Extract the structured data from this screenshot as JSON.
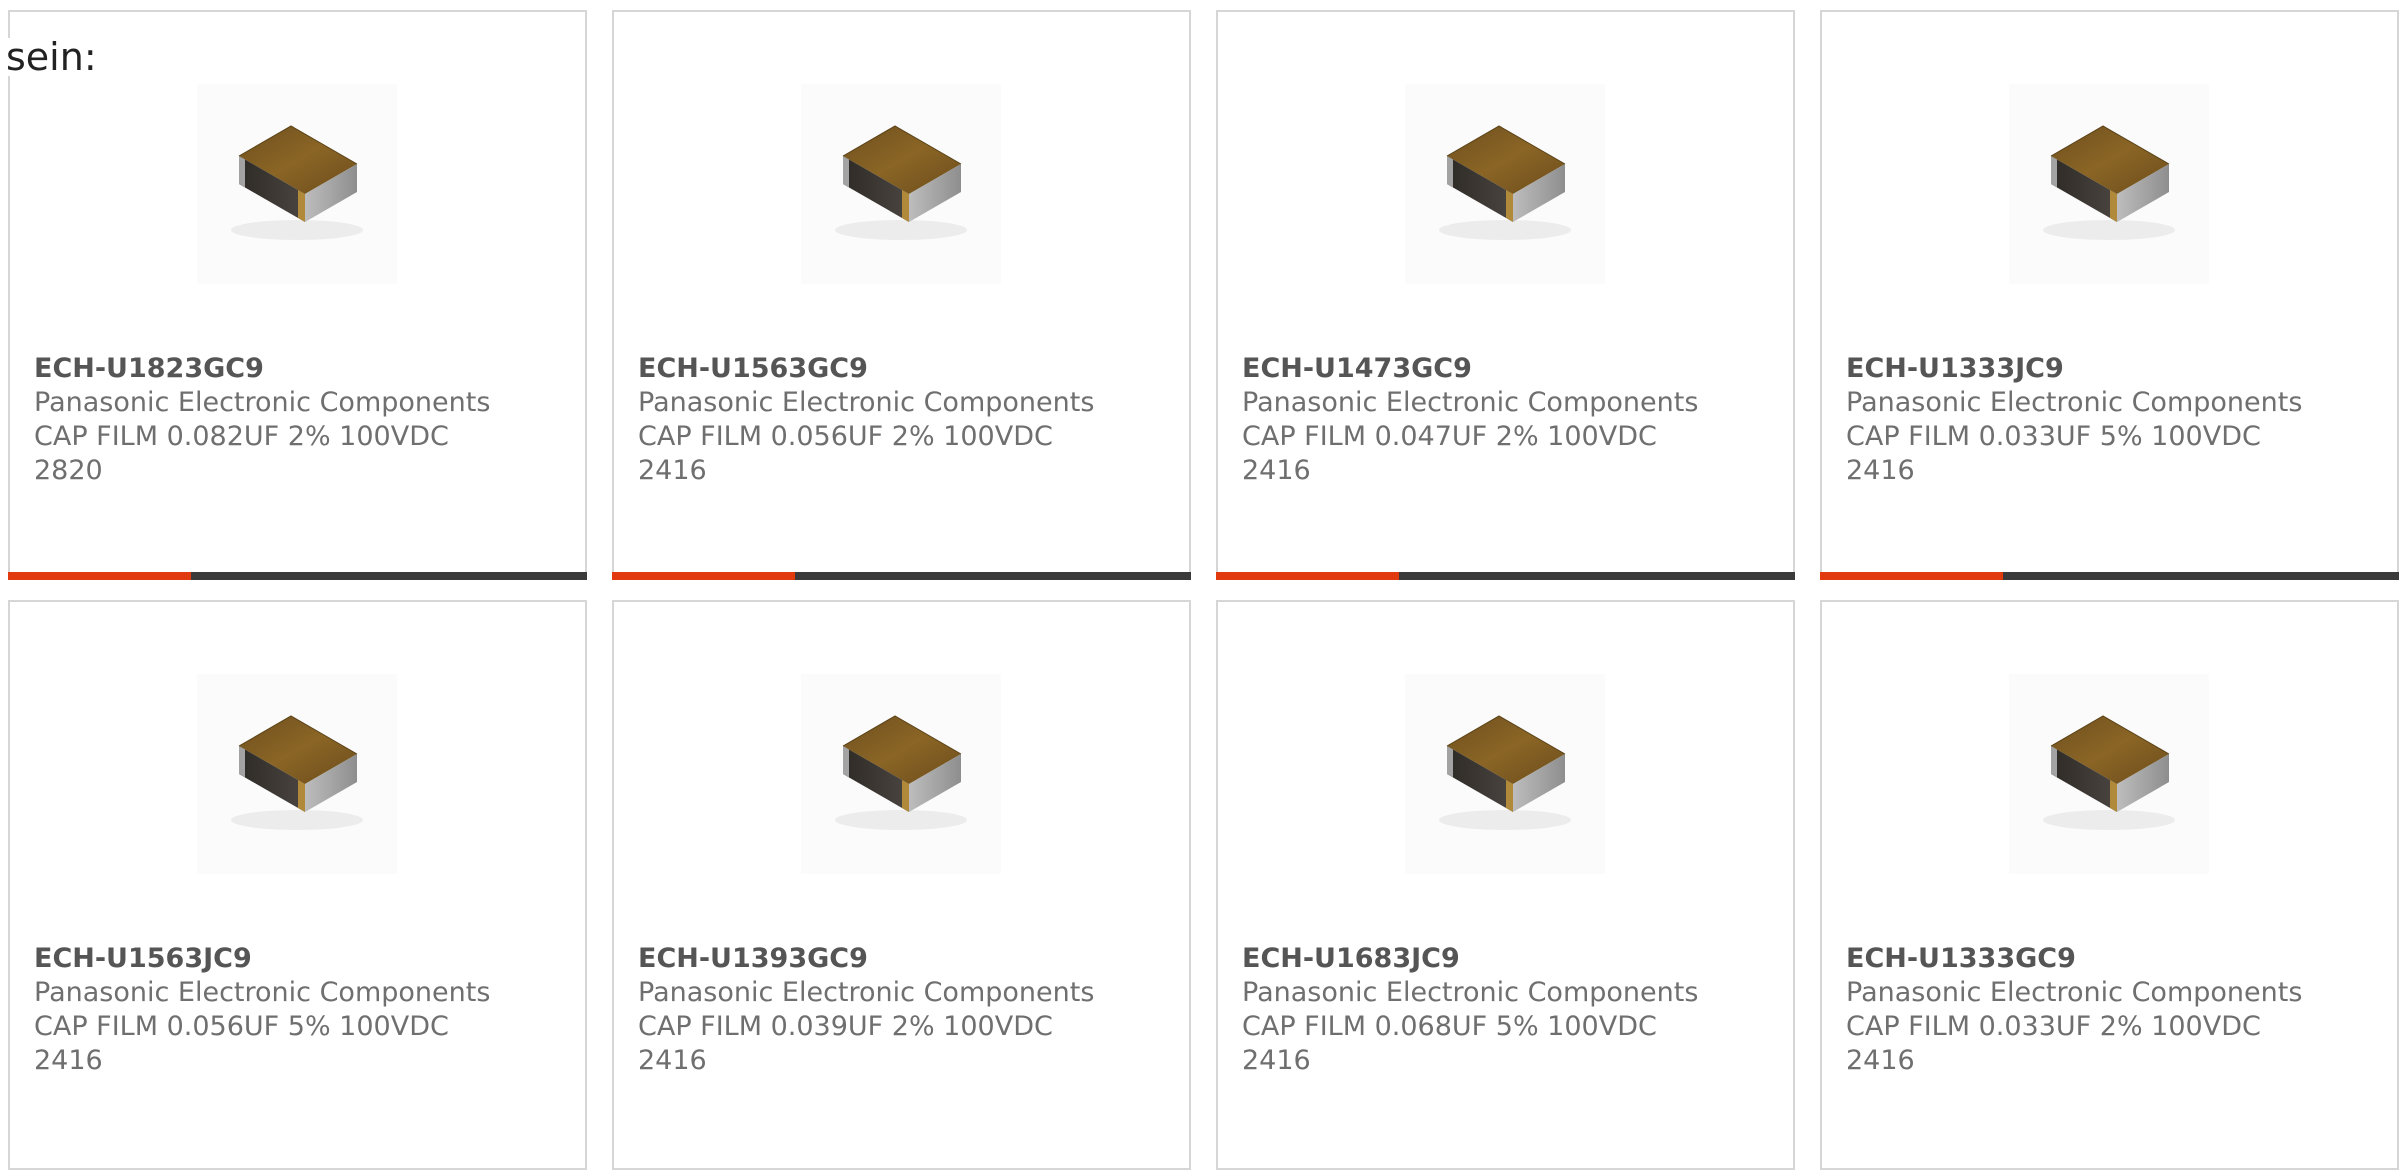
{
  "intro_text": "sein:",
  "products": [
    {
      "part": "ECH-U1823GC9",
      "manufacturer": "Panasonic Electronic Components",
      "description": "CAP FILM 0.082UF 2% 100VDC",
      "package": "2820"
    },
    {
      "part": "ECH-U1563GC9",
      "manufacturer": "Panasonic Electronic Components",
      "description": "CAP FILM 0.056UF 2% 100VDC",
      "package": "2416"
    },
    {
      "part": "ECH-U1473GC9",
      "manufacturer": "Panasonic Electronic Components",
      "description": "CAP FILM 0.047UF 2% 100VDC",
      "package": "2416"
    },
    {
      "part": "ECH-U1333JC9",
      "manufacturer": "Panasonic Electronic Components",
      "description": "CAP FILM 0.033UF 5% 100VDC",
      "package": "2416"
    },
    {
      "part": "ECH-U1563JC9",
      "manufacturer": "Panasonic Electronic Components",
      "description": "CAP FILM 0.056UF 5% 100VDC",
      "package": "2416"
    },
    {
      "part": "ECH-U1393GC9",
      "manufacturer": "Panasonic Electronic Components",
      "description": "CAP FILM 0.039UF 2% 100VDC",
      "package": "2416"
    },
    {
      "part": "ECH-U1683JC9",
      "manufacturer": "Panasonic Electronic Components",
      "description": "CAP FILM 0.068UF 5% 100VDC",
      "package": "2416"
    },
    {
      "part": "ECH-U1333GC9",
      "manufacturer": "Panasonic Electronic Components",
      "description": "CAP FILM 0.033UF 2% 100VDC",
      "package": "2416"
    }
  ],
  "product_image_icon": "smd-film-capacitor-icon",
  "colors": {
    "accent": "#e03a0e",
    "bar": "#3a3a3a",
    "card_border": "#d6d6d6",
    "text_muted": "#6f6f6f"
  }
}
